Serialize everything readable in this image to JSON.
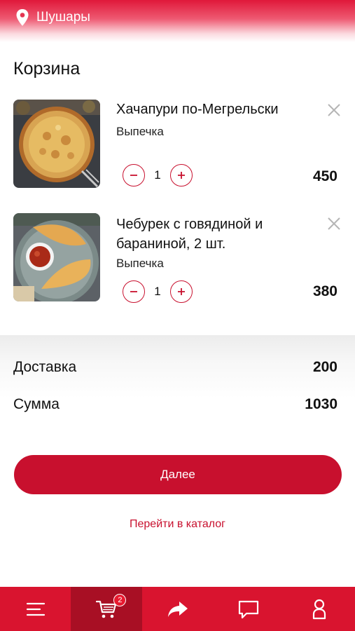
{
  "header": {
    "location": "Шушары",
    "location_icon": "map-pin-icon"
  },
  "page": {
    "title": "Корзина"
  },
  "cart": {
    "items": [
      {
        "name": "Хачапури по-Мегрельски",
        "category": "Выпечка",
        "quantity": "1",
        "price": "450",
        "image": "khachapuri-image"
      },
      {
        "name": "Чебурек с говядиной и бараниной, 2 шт.",
        "category": "Выпечка",
        "quantity": "1",
        "price": "380",
        "image": "cheburek-image"
      }
    ]
  },
  "summary": {
    "delivery_label": "Доставка",
    "delivery_value": "200",
    "total_label": "Сумма",
    "total_value": "1030"
  },
  "actions": {
    "next_label": "Далее",
    "catalog_link": "Перейти в каталог"
  },
  "nav": {
    "items": [
      {
        "icon": "menu-icon"
      },
      {
        "icon": "cart-icon",
        "badge": "2",
        "active": true
      },
      {
        "icon": "share-icon"
      },
      {
        "icon": "chat-icon"
      },
      {
        "icon": "profile-icon"
      }
    ]
  },
  "colors": {
    "accent": "#c8102e",
    "navbar": "#d9142f",
    "navbar_active": "#a80f24"
  }
}
